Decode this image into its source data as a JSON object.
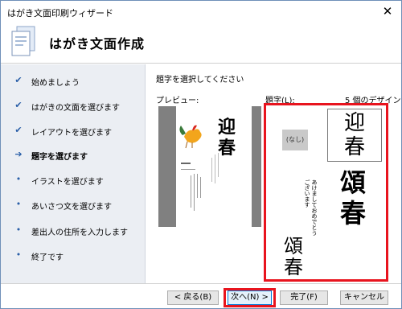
{
  "window": {
    "title": "はがき文面印刷ウィザード",
    "close_glyph": "✕"
  },
  "header": {
    "page_title": "はがき文面作成",
    "icon": "wizard-document-icon"
  },
  "sidebar": {
    "steps": [
      {
        "label": "始めましょう",
        "mark": "✔"
      },
      {
        "label": "はがきの文面を選びます",
        "mark": "✔"
      },
      {
        "label": "レイアウトを選びます",
        "mark": "✔"
      },
      {
        "label": "題字を選びます",
        "mark": "➔"
      },
      {
        "label": "イラストを選びます",
        "mark": "•"
      },
      {
        "label": "あいさつ文を選びます",
        "mark": "•"
      },
      {
        "label": "差出人の住所を入力します",
        "mark": "•"
      },
      {
        "label": "終了です",
        "mark": "•"
      }
    ],
    "current_index": 3
  },
  "main": {
    "instruction": "題字を選択してください",
    "preview_label": "プレビュー:",
    "title_label": "題字(L):",
    "design_count": "5 個のデザイン",
    "design_none": "(なし)",
    "calligraphy": {
      "geiga_top": "迎",
      "geiga_bottom": "春",
      "gashun_top": "頌",
      "gashun_bottom": "春",
      "akemashite": "あけましておめでとうございます",
      "preview_title_top": "迎",
      "preview_title_bottom": "春"
    }
  },
  "footer": {
    "back": "< 戻る(B)",
    "next": "次へ(N) >",
    "finish": "完了(F)",
    "cancel": "キャンセル"
  },
  "colors": {
    "highlight": "#e8141e",
    "sidebar_bg": "#ebeef3",
    "check": "#2a5fa8"
  }
}
